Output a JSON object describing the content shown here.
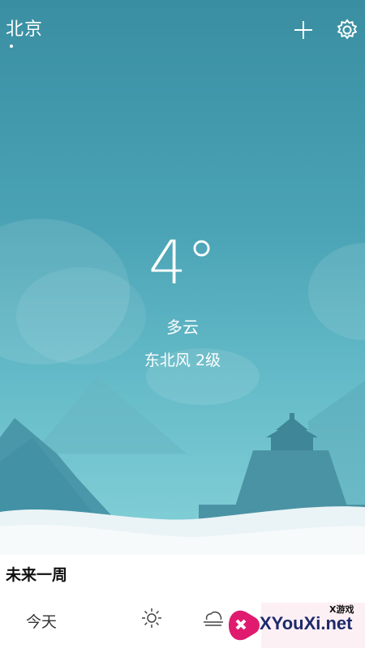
{
  "header": {
    "city": "北京",
    "add_icon": "plus-icon",
    "settings_icon": "gear-icon"
  },
  "current": {
    "temperature": "4°",
    "condition": "多云",
    "wind": "东北风 2级"
  },
  "forecast": {
    "title": "未来一周",
    "rows": [
      {
        "day": "今天",
        "day_icon": "sun-icon",
        "night_icon": "fog-icon"
      }
    ]
  },
  "watermark": {
    "small": "X游戏",
    "text": "XYouXi.net"
  }
}
